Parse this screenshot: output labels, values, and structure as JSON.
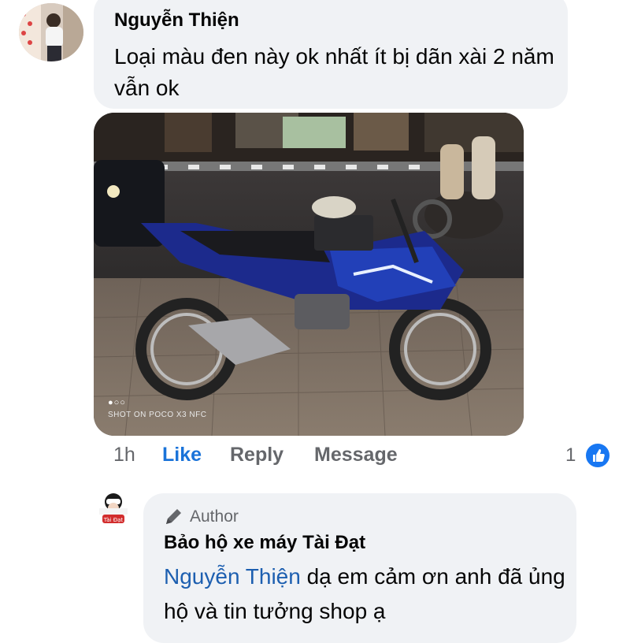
{
  "comment": {
    "author_name": "Nguyễn Thiện",
    "text": "Loại màu đen này ok nhất ít bị dãn xài 2 năm vẫn ok",
    "photo": {
      "dots_glyph": "●○○",
      "watermark": "SHOT ON POCO X3 NFC"
    },
    "actions": {
      "time": "1h",
      "like_label": "Like",
      "reply_label": "Reply",
      "message_label": "Message"
    },
    "reaction_count": "1",
    "reaction_icon": "like-thumb-icon",
    "colors": {
      "link": "#1a73d9",
      "muted": "#65676b",
      "bubble": "#f0f2f5"
    }
  },
  "reply": {
    "badge_icon": "pencil-icon",
    "badge_label": "Author",
    "author_name": "Bảo hộ xe máy Tài Đạt",
    "mention": "Nguyễn Thiện",
    "text": " dạ em cảm ơn anh đã ủng hộ và tin tưởng shop ạ",
    "avatar_text": "Tài Đạt"
  }
}
